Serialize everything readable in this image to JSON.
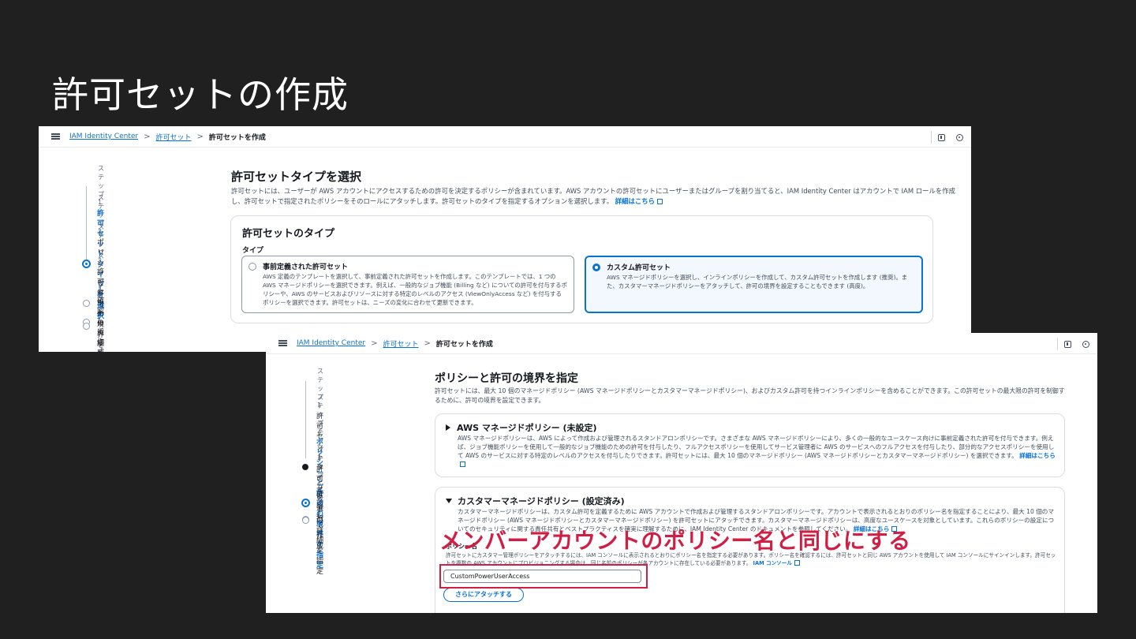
{
  "slide": {
    "title": "許可セットの作成"
  },
  "screen1": {
    "breadcrumb": {
      "home": "IAM Identity Center",
      "parent": "許可セット",
      "current": "許可セットを作成"
    },
    "steps": [
      {
        "number": "ステップ 1",
        "label": "許可セットタイプを選択",
        "state": "active"
      },
      {
        "number": "ステップ 2",
        "label": "ポリシーと許可の境界を指定",
        "state": "pending"
      },
      {
        "number": "ステップ 3",
        "label": "許可セットの詳細を指定",
        "state": "pending"
      },
      {
        "number": "ステップ 4",
        "label": "確認して作成",
        "state": "pending"
      }
    ],
    "heading": "許可セットタイプを選択",
    "description": "許可セットには、ユーザーが AWS アカウントにアクセスするための許可を決定するポリシーが含まれています。AWS アカウントの許可セットにユーザーまたはグループを割り当てると、IAM Identity Center はアカウントで IAM ロールを作成し、許可セットで指定されたポリシーをそのロールにアタッチします。許可セットのタイプを指定するオプションを選択します。",
    "learn_more": "詳細はこちら",
    "card_title": "許可セットのタイプ",
    "type_label": "タイプ",
    "options": [
      {
        "title": "事前定義された許可セット",
        "desc": "AWS 定義のテンプレートを選択して、事前定義された許可セットを作成します。このテンプレートでは、1 つの AWS マネージドポリシーを選択できます。例えば、一般的なジョブ機能 (Billing など) についての許可を付与するポリシーや、AWS のサービスおよびリソースに対する特定のレベルのアクセス (ViewOnlyAccess など) を付与するポリシーを選択できます。許可セットは、ニーズの変化に合わせて更新できます。",
        "selected": false
      },
      {
        "title": "カスタム許可セット",
        "desc": "AWS マネージドポリシーを選択し、インラインポリシーを作成して、カスタム許可セットを作成します (推奨)。また、カスタマーマネージドポリシーをアタッチして、許可の境界を設定することもできます (高度)。",
        "selected": true
      }
    ]
  },
  "screen2": {
    "breadcrumb": {
      "home": "IAM Identity Center",
      "parent": "許可セット",
      "current": "許可セットを作成"
    },
    "steps": [
      {
        "number": "ステップ 1",
        "label": "許可セットタイプを選択",
        "state": "done"
      },
      {
        "number": "ステップ 2",
        "label": "ポリシーと許可の境界を指定",
        "state": "active"
      },
      {
        "number": "ステップ 3",
        "label": "許可セットの詳細を指定",
        "state": "pending"
      },
      {
        "number": "ステップ 4",
        "label": "確認して作成",
        "state": "pending"
      }
    ],
    "heading": "ポリシーと許可の境界を指定",
    "description": "許可セットには、最大 10 個のマネージドポリシー (AWS マネージドポリシーとカスタマーマネージドポリシー)、およびカスタム許可を持つインラインポリシーを含めることができます。この許可セットの最大限の許可を制御するために、許可の境界を設定できます。",
    "aws_managed": {
      "title": "AWS マネージドポリシー (未設定)",
      "desc": "AWS マネージドポリシーは、AWS によって作成および管理されるスタンドアロンポリシーです。さまざまな AWS マネージドポリシーにより、多くの一般的なユースケース向けに事前定義された許可を付与できます。例えば、ジョブ機能ポリシーを使用して一般的なジョブ機能のための許可を付与したり、フルアクセスポリシーを使用してサービス管理者に AWS のサービスへのフルアクセスを付与したり、部分的なアクセスポリシーを使用して AWS のサービスに対する特定のレベルのアクセスを付与したりできます。許可セットには、最大 10 個のマネージドポリシー (AWS マネージドポリシーとカスタマーマネージドポリシー) を選択できます。",
      "learn_more": "詳細はこちら"
    },
    "customer_managed": {
      "title": "カスタマーマネージドポリシー (設定済み)",
      "desc": "カスタマーマネージドポリシーは、カスタム許可を定義するために AWS アカウントで作成および管理するスタンドアロンポリシーです。アカウントで表示されるとおりのポリシー名を指定することにより、最大 10 個のマネージドポリシー (AWS マネージドポリシーとカスタマーマネージドポリシー) を許可セットにアタッチできます。カスタマーマネージドポリシーは、高度なユースケースを対象としています。これらのポリシーの設定についてのセキュリティに関する責任共有とベストプラクティスを確実に理解するために、IAM Identity Center のドキュメントを参照してください。",
      "learn_more": "詳細はこちら",
      "field_label": "ポリシー名",
      "field_desc": "許可セットにカスタマー管理ポリシーをアタッチするには、IAM コンソールに表示されるとおりにポリシー名を指定する必要があります。ポリシー名を確認するには、許可セットと同じ AWS アカウントを使用して IAM コンソールにサインインします。許可セットを複数の AWS アカウントにプロビジョニングする場合は、同じ名前のポリシーが各アカウントに存在している必要があります。",
      "console_link": "IAM コンソール",
      "policy_value": "CustomPowerUserAccess",
      "attach_button": "さらにアタッチする"
    },
    "annotation": "メンバーアカウントのポリシー名と同じにする"
  },
  "colors": {
    "accent": "#0972d3",
    "annotation": "#d01f45",
    "background": "#202020"
  }
}
